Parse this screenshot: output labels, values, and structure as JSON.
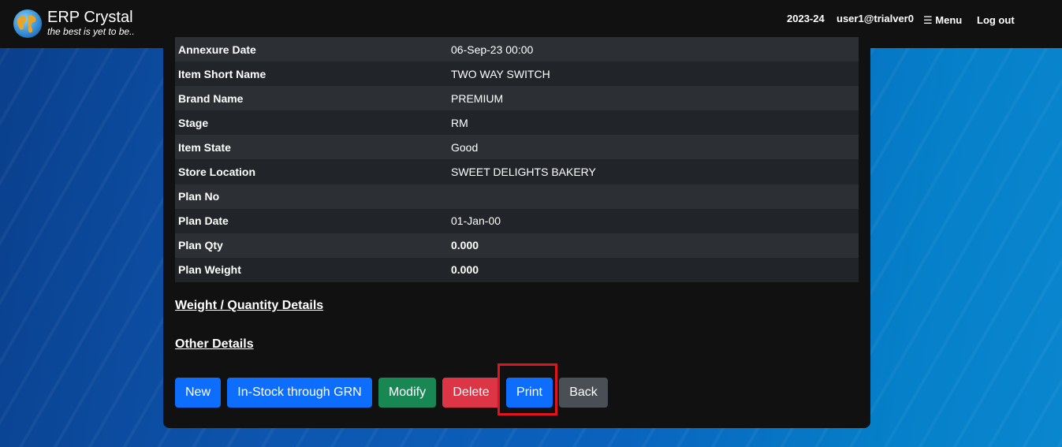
{
  "header": {
    "brand_name": "ERP Crystal",
    "tagline": "the best is yet to be..",
    "year": "2023-24",
    "user": "user1@trialver0",
    "menu_label": "☰ Menu",
    "logout_label": "Log out"
  },
  "details": {
    "rows": [
      {
        "label": "Annexure Date",
        "value": "06-Sep-23 00:00"
      },
      {
        "label": "Item Short Name",
        "value": "TWO WAY SWITCH"
      },
      {
        "label": "Brand Name",
        "value": "PREMIUM"
      },
      {
        "label": "Stage",
        "value": "RM"
      },
      {
        "label": "Item State",
        "value": "Good"
      },
      {
        "label": "Store Location",
        "value": "SWEET DELIGHTS BAKERY"
      },
      {
        "label": "Plan No",
        "value": ""
      },
      {
        "label": "Plan Date",
        "value": "01-Jan-00"
      },
      {
        "label": "Plan Qty",
        "value": "0.000"
      },
      {
        "label": "Plan Weight",
        "value": "0.000"
      }
    ]
  },
  "sections": {
    "weight_quantity": "Weight / Quantity Details",
    "other": "Other Details"
  },
  "buttons": {
    "new": "New",
    "instock": "In-Stock through GRN",
    "modify": "Modify",
    "delete": "Delete",
    "print": "Print",
    "back": "Back"
  },
  "colors": {
    "primary": "#0d6efd",
    "success": "#198754",
    "danger": "#dc3545",
    "secondary": "#4a4f55",
    "highlight": "#e0141e"
  }
}
